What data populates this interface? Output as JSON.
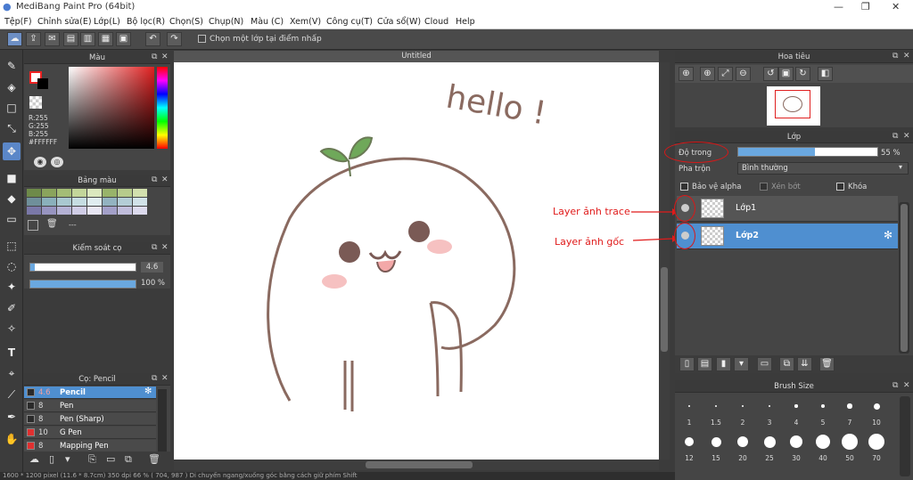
{
  "window": {
    "title": "MediBang Paint Pro (64bit)"
  },
  "menu": [
    "Tệp(F)",
    "Chỉnh sửa(E)",
    "Lớp(L)",
    "Bộ lọc(R)",
    "Chọn(S)",
    "Chụp(N)",
    "Màu (C)",
    "Xem(V)",
    "Công cụ(T)",
    "Cửa sổ(W)",
    "Cloud",
    "Help"
  ],
  "toolbar": {
    "select_layer_label": "Chọn một lớp tại điểm nhấp"
  },
  "color_panel": {
    "title": "Màu",
    "r": "R:255",
    "g": "G:255",
    "b": "B:255",
    "hex": "#FFFFFF",
    "foreground": "#ffffff",
    "background": "#000000"
  },
  "palette_panel": {
    "title": "Bảng màu",
    "more": "---",
    "colors": [
      "#6e8a4a",
      "#8aa45c",
      "#a4bd76",
      "#c3d69a",
      "#dbe8be",
      "#98b36a",
      "#b6cb8c",
      "#d2e0ae",
      "#6f8f9a",
      "#8ab0bb",
      "#a9c8d0",
      "#c6dde2",
      "#e0edf0",
      "#93b3c0",
      "#b3cdd6",
      "#d1e2e8",
      "#7a78a8",
      "#9794c0",
      "#b4b1d4",
      "#d0cde6",
      "#e8e6f3",
      "#a3a0c8",
      "#c0bddb",
      "#dcdaed"
    ]
  },
  "brush_control": {
    "title": "Kiểm soát cọ",
    "size": "4.6",
    "size_fraction": 0.04,
    "opacity": "100 %",
    "opacity_fraction": 1.0
  },
  "brush_list": {
    "title": "Cọ: Pencil",
    "items": [
      {
        "size": "4.6",
        "name": "Pencil",
        "color": "#2a2a2a",
        "selected": true
      },
      {
        "size": "8",
        "name": "Pen",
        "color": "#2a2a2a",
        "selected": false
      },
      {
        "size": "8",
        "name": "Pen (Sharp)",
        "color": "#2a2a2a",
        "selected": false
      },
      {
        "size": "10",
        "name": "G Pen",
        "color": "#e03030",
        "selected": false
      },
      {
        "size": "8",
        "name": "Mapping Pen",
        "color": "#e03030",
        "selected": false
      }
    ]
  },
  "canvas": {
    "tab": "Untitled",
    "hello": "hello !"
  },
  "navigator": {
    "title": "Hoa tiêu"
  },
  "layers_panel": {
    "title": "Lớp",
    "opacity_label": "Độ trong",
    "opacity_value": "55 %",
    "opacity_fraction": 0.55,
    "blend_label": "Pha trộn",
    "blend_value": "Bình thường",
    "protect_alpha": "Bảo vệ alpha",
    "clipping": "Xén bớt",
    "lock": "Khóa",
    "layers": [
      {
        "name": "Lớp1",
        "selected": false
      },
      {
        "name": "Lớp2",
        "selected": true
      }
    ]
  },
  "annotations": {
    "trace": "Layer ảnh trace",
    "original": "Layer ảnh gốc"
  },
  "brush_size_panel": {
    "title": "Brush Size",
    "row1": [
      "1",
      "1.5",
      "2",
      "3",
      "4",
      "5",
      "7",
      "10"
    ],
    "row2": [
      "12",
      "15",
      "20",
      "25",
      "30",
      "40",
      "50",
      "70"
    ]
  },
  "status_bar": {
    "text": "1600 * 1200 pixel  (11.6 * 8.7cm)  350 dpi  66 %  ( 704, 987 )  Di chuyển ngang/xuống góc bằng cách giữ phím Shift"
  }
}
